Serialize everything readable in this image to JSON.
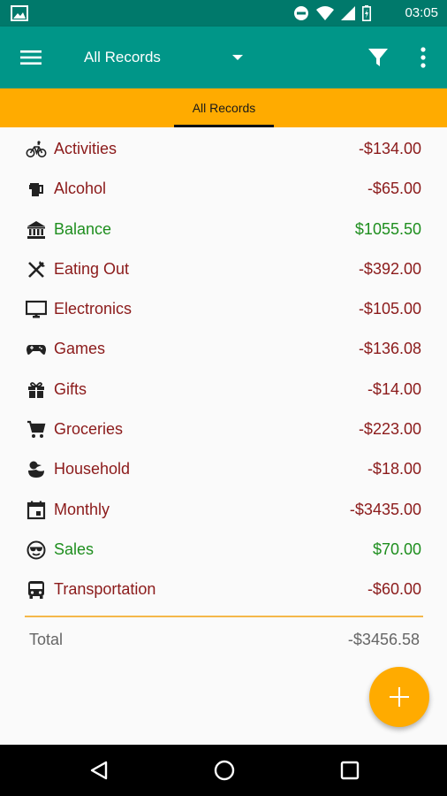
{
  "status_bar": {
    "time": "03:05",
    "icons": [
      "gallery-icon",
      "do-not-disturb-icon",
      "wifi-icon",
      "signal-icon",
      "battery-charging-icon"
    ]
  },
  "toolbar": {
    "spinner_label": "All Records",
    "icons": [
      "menu-icon",
      "dropdown-arrow-icon",
      "filter-icon",
      "more-vert-icon"
    ]
  },
  "tabs": [
    {
      "label": "All Records",
      "selected": true
    }
  ],
  "colors": {
    "status_bar": "#00796b",
    "toolbar": "#009688",
    "tab_bar": "#ffab00",
    "fab": "#ffab00",
    "negative": "#8b1a1a",
    "positive": "#1e8e1e",
    "divider": "#f5b84a"
  },
  "categories": [
    {
      "name": "Activities",
      "amount": "-$134.00",
      "icon": "bicycle-icon",
      "sign": "negative"
    },
    {
      "name": "Alcohol",
      "amount": "-$65.00",
      "icon": "beer-icon",
      "sign": "negative"
    },
    {
      "name": "Balance",
      "amount": "$1055.50",
      "icon": "bank-icon",
      "sign": "positive"
    },
    {
      "name": "Eating Out",
      "amount": "-$392.00",
      "icon": "cutlery-icon",
      "sign": "negative"
    },
    {
      "name": "Electronics",
      "amount": "-$105.00",
      "icon": "monitor-icon",
      "sign": "negative"
    },
    {
      "name": "Games",
      "amount": "-$136.08",
      "icon": "gamepad-icon",
      "sign": "negative"
    },
    {
      "name": "Gifts",
      "amount": "-$14.00",
      "icon": "gift-icon",
      "sign": "negative"
    },
    {
      "name": "Groceries",
      "amount": "-$223.00",
      "icon": "cart-icon",
      "sign": "negative"
    },
    {
      "name": "Household",
      "amount": "-$18.00",
      "icon": "duck-icon",
      "sign": "negative"
    },
    {
      "name": "Monthly",
      "amount": "-$3435.00",
      "icon": "calendar-icon",
      "sign": "negative"
    },
    {
      "name": "Sales",
      "amount": "$70.00",
      "icon": "sunglasses-face-icon",
      "sign": "positive"
    },
    {
      "name": "Transportation",
      "amount": "-$60.00",
      "icon": "bus-icon",
      "sign": "negative"
    }
  ],
  "total": {
    "label": "Total",
    "value": "-$3456.58"
  },
  "fab": {
    "icon": "plus-icon"
  },
  "nav_bar": {
    "icons": [
      "back-icon",
      "home-icon",
      "recents-icon"
    ]
  }
}
